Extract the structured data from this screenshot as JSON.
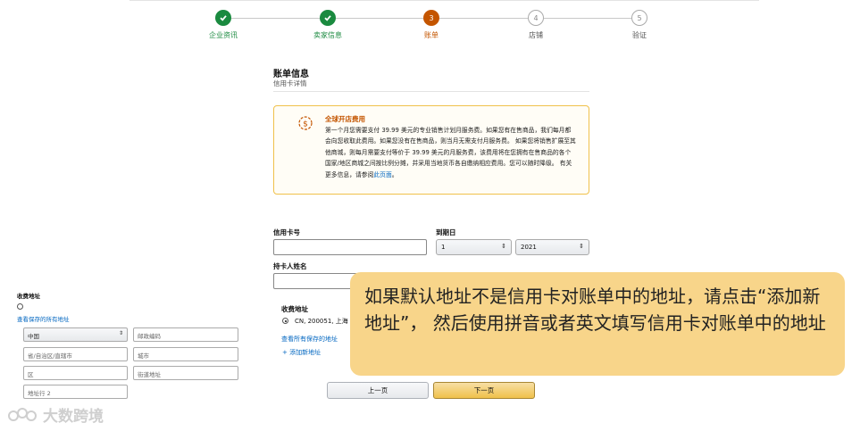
{
  "stepper": {
    "steps": [
      {
        "label": "企业资讯",
        "state": "done",
        "num": ""
      },
      {
        "label": "卖家信息",
        "state": "done",
        "num": ""
      },
      {
        "label": "账单",
        "state": "current",
        "num": "3"
      },
      {
        "label": "店铺",
        "state": "todo",
        "num": "4"
      },
      {
        "label": "验证",
        "state": "todo",
        "num": "5"
      }
    ]
  },
  "billing": {
    "title": "账单信息",
    "subtitle": "信用卡详情"
  },
  "notice": {
    "icon": "currency-exchange-icon",
    "title": "全球开店费用",
    "body": "第一个月您需要支付 39.99 美元的专业销售计划月服务费。如果您有在售商品，我们每月都会向您收取此费用。如果您没有在售商品，则当月无需支付月服务费。 如果您将销售扩展至其他商城，则每月需要支付等价于 39.99 美元的月服务费，该费用将在您拥有在售商品的各个国家/地区商城之间按比例分摊，并采用当地货币各自缴纳相应费用。您可以随时降级。 有关更多信息，请参阅",
    "link": "此页面",
    "end": "。"
  },
  "form": {
    "card_number_label": "信用卡号",
    "expiry_label": "到期日",
    "expiry_month": "1",
    "expiry_year": "2021",
    "cardholder_label": "持卡人姓名",
    "billing_address_label": "收费地址",
    "address_option": "CN, 200051, 上海",
    "view_saved_link": "查看所有保存的地址",
    "add_address_link": "+ 添加新地址"
  },
  "buttons": {
    "prev": "上一页",
    "next": "下一页"
  },
  "mini_form": {
    "title": "收费地址",
    "saved_link": "查看保存的所有地址",
    "country": "中国",
    "postcode_placeholder": "邮政编码",
    "province_placeholder": "省/自治区/直辖市",
    "city_placeholder": "城市",
    "district_placeholder": "区",
    "street_placeholder": "街道地址",
    "address2_placeholder": "地址行 2"
  },
  "callout": {
    "text": "如果默认地址不是信用卡对账单中的地址，请点击“添加新地址”， 然后使用拼音或者英文填写信用卡对账单中的地址"
  },
  "watermark": {
    "text": "大数跨境"
  },
  "colors": {
    "done": "#1a8a3f",
    "current": "#c45500",
    "link": "#0066c0",
    "callout_bg": "#f8d58a",
    "next_button": "#f0c14b"
  }
}
